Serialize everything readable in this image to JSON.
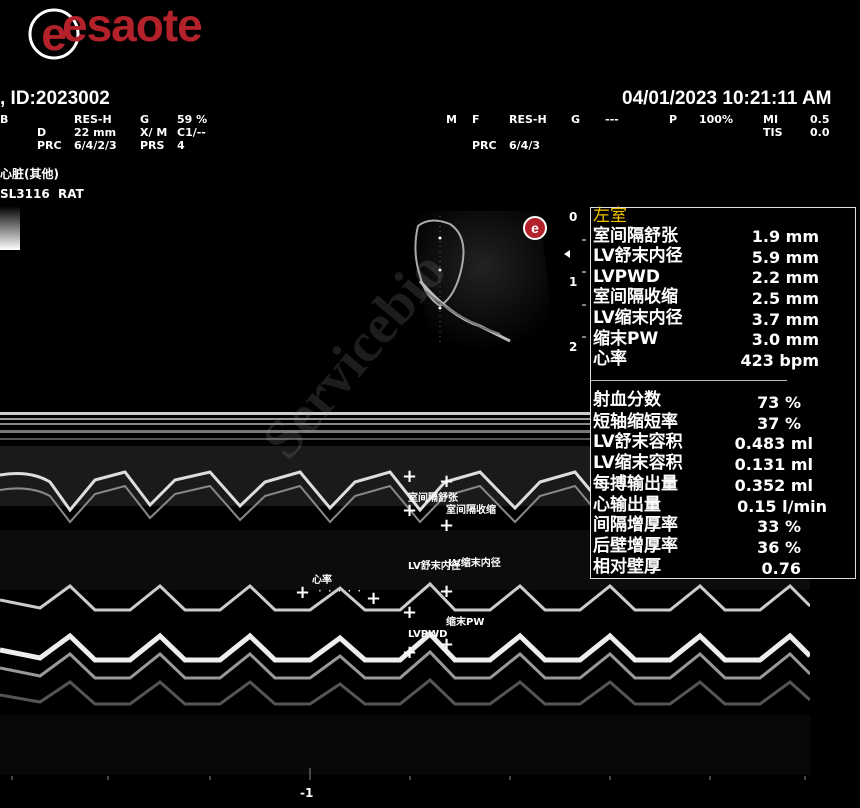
{
  "header": {
    "brand": "esaote",
    "patient_id": ", ID:2023002",
    "datetime": "04/01/2023 10:21:11 AM"
  },
  "params_left": {
    "b": "B",
    "res_h": "RES-H",
    "g": "G",
    "g_val": "59 %",
    "d": "D",
    "d_val": "22 mm",
    "xm": "X/ M",
    "xm_val": "C1/--",
    "prc": "PRC",
    "prc_val": "6/4/2/3",
    "prs": "PRS",
    "prs_val": "4"
  },
  "params_right": {
    "m": "M",
    "f": "F",
    "res_h": "RES-H",
    "g": "G",
    "g_val": "---",
    "p": "P",
    "p_val": "100%",
    "mi": "MI",
    "mi_val": "0.5",
    "tis": "TIS",
    "tis_val": "0.0",
    "prc": "PRC",
    "prc_val": "6/4/3"
  },
  "exam": {
    "preset": "心脏(其他)",
    "probe": "SL3116",
    "species": "RAT"
  },
  "depth_scale": [
    "0",
    "1",
    "2"
  ],
  "time_scale": "-1",
  "watermark": "Servicebio",
  "measurements": {
    "title": "左室",
    "title_color": "#f2c200",
    "rows": [
      {
        "label": "室间隔舒张",
        "value": "1.9 mm"
      },
      {
        "label": "LV舒末内径",
        "value": "5.9 mm"
      },
      {
        "label": "LVPWD",
        "value": "2.2 mm"
      },
      {
        "label": "室间隔收缩",
        "value": "2.5 mm"
      },
      {
        "label": "LV缩末内径",
        "value": "3.7 mm"
      },
      {
        "label": "缩末PW",
        "value": "3.0 mm"
      },
      {
        "label": "心率",
        "value": "423 bpm"
      }
    ],
    "derived": [
      {
        "label": "射血分数",
        "value": "73 %"
      },
      {
        "label": "短轴缩短率",
        "value": "37 %"
      },
      {
        "label": "LV舒末容积",
        "value": "0.483 ml"
      },
      {
        "label": "LV缩末容积",
        "value": "0.131 ml"
      },
      {
        "label": "每搏输出量",
        "value": "0.352 ml"
      },
      {
        "label": "心输出量",
        "value": "0.15 l/min"
      },
      {
        "label": "间隔增厚率",
        "value": "33 %"
      },
      {
        "label": "后壁增厚率",
        "value": "36 %"
      },
      {
        "label": "相对壁厚",
        "value": "0.76"
      }
    ]
  },
  "calipers": {
    "ivsd": "室间隔舒张",
    "ivss": "室间隔收缩",
    "lvidd": "LV舒末内径",
    "lvids": "LV缩末内径",
    "hr": "心率",
    "lvpws": "缩末PW",
    "lvpwd": "LVPWD"
  }
}
